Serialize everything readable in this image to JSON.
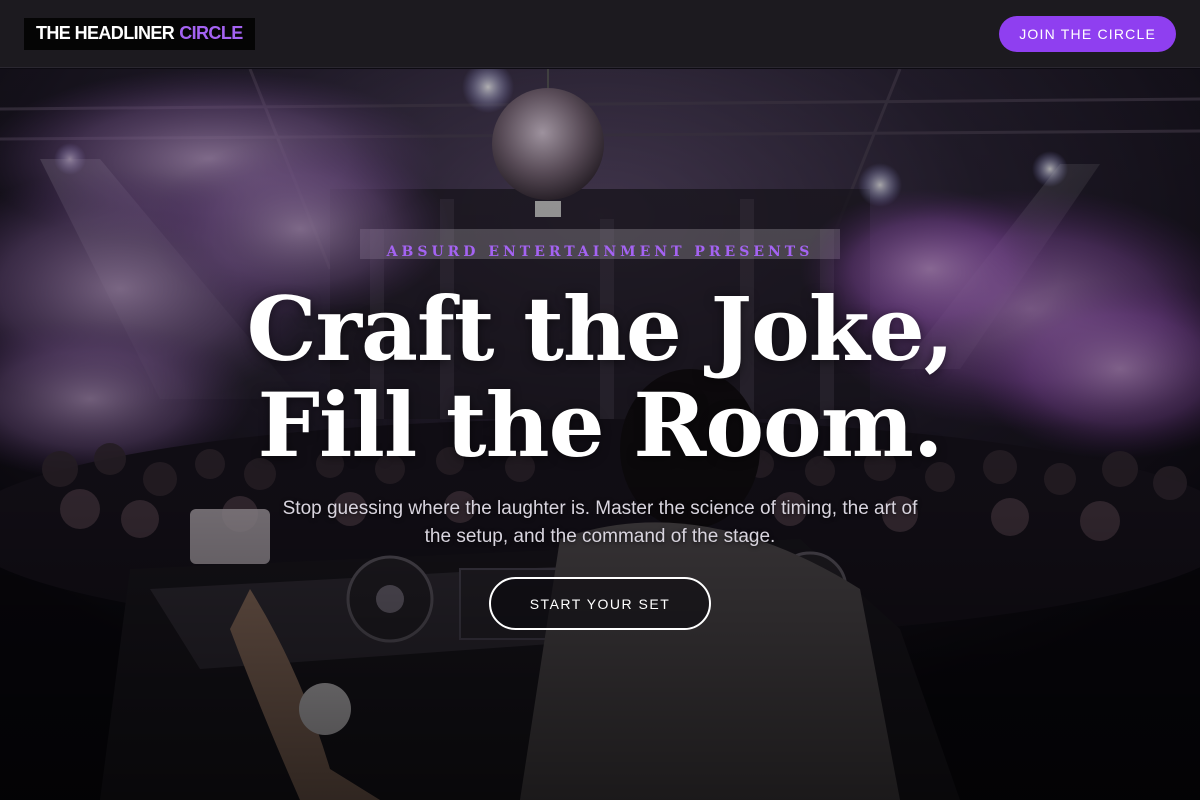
{
  "header": {
    "logo_main": "THE HEADLINER",
    "logo_accent": "CIRCLE",
    "join_label": "JOIN THE CIRCLE"
  },
  "hero": {
    "eyebrow": "ABSURD ENTERTAINMENT PRESENTS",
    "headline_line1": "Craft the Joke,",
    "headline_line2": "Fill the Room.",
    "subtext": "Stop guessing where the laughter is. Master the science of timing, the art of the setup, and the command of the stage.",
    "cta_label": "START YOUR SET"
  },
  "colors": {
    "accent": "#a463f2",
    "button_bg": "#8f3ff0",
    "header_bg": "#1c1a1f"
  }
}
